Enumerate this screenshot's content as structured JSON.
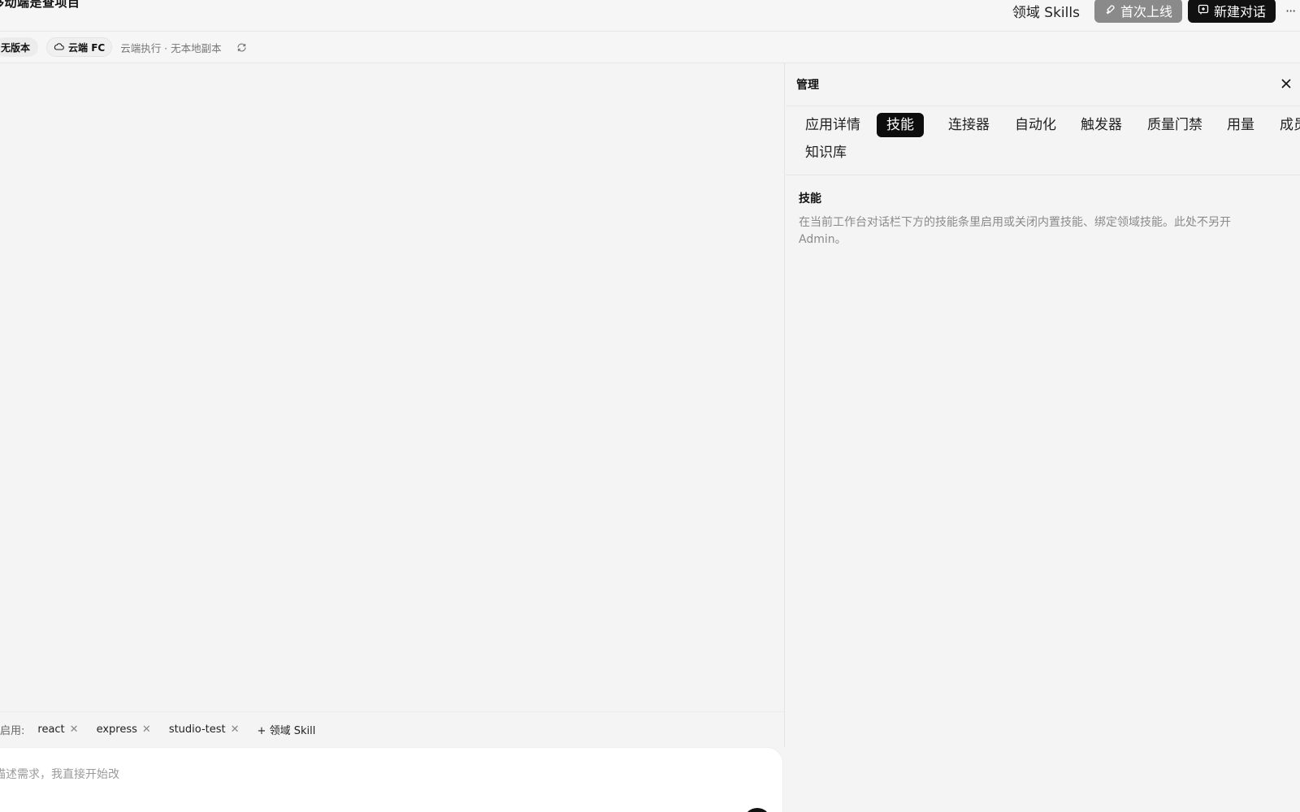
{
  "header": {
    "project_title": "移动端是查项目",
    "skills_link": "领域 Skills",
    "launch_button": "首次上线",
    "new_chat_button": "新建对话",
    "more_icon": "more-icon"
  },
  "subbar": {
    "version_chip": "无版本",
    "cloud_chip": "云端 FC",
    "cloud_status": "云端执行 · 无本地副本"
  },
  "skillbar": {
    "enabled_label": "启用:",
    "skills": [
      "react",
      "express",
      "studio-test"
    ],
    "add_skill": "+ 领域 Skill"
  },
  "composer": {
    "placeholder": "描述需求，我直接开始改"
  },
  "panel": {
    "title": "管理",
    "tabs": [
      "应用详情",
      "技能",
      "连接器",
      "自动化",
      "触发器",
      "质量门禁",
      "用量",
      "成员",
      "知识库"
    ],
    "active_tab": "技能",
    "section_title": "技能",
    "section_desc": "在当前工作台对话栏下方的技能条里启用或关闭内置技能、绑定领域技能。此处不另开 Admin。"
  },
  "colors": {
    "background": "#f4f4f4",
    "primary_dark": "#111111",
    "launch_gray": "#8a8a8a"
  }
}
